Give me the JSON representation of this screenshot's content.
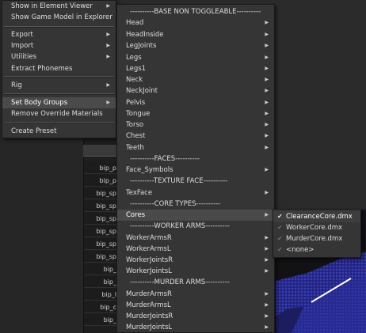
{
  "main_menu": {
    "items": [
      {
        "label": "Show in Element Viewer",
        "submenu": true
      },
      {
        "label": "Show Game Model in Explorer",
        "submenu": false
      },
      {
        "label": "Export",
        "submenu": true
      },
      {
        "label": "Import",
        "submenu": true
      },
      {
        "label": "Utilities",
        "submenu": true
      },
      {
        "label": "Extract Phonemes",
        "submenu": false
      },
      {
        "label": "Rig",
        "submenu": true
      },
      {
        "label": "Set Body Groups",
        "submenu": true,
        "highlighted": true
      },
      {
        "label": "Remove Override Materials",
        "submenu": false
      },
      {
        "label": "Create Preset",
        "submenu": false
      }
    ]
  },
  "body_groups_menu": {
    "headers": {
      "base": "----------BASE NON TOGGLEABLE----------",
      "faces": "----------FACES----------",
      "texture_face": "----------TEXTURE FACE----------",
      "core_types": "----------CORE TYPES----------",
      "worker_arms": "----------WORKER ARMS----------",
      "murder_arms": "----------MURDER ARMS----------"
    },
    "items": {
      "head": "Head",
      "headinside": "HeadInside",
      "legjoints": "LegJoints",
      "legs": "Legs",
      "legs1": "Legs1",
      "neck": "Neck",
      "neckjoint": "NeckJoint",
      "pelvis": "Pelvis",
      "tongue": "Tongue",
      "torso": "Torso",
      "chest": "Chest",
      "teeth": "Teeth",
      "face_symbols": "Face_Symbols",
      "texface": "TexFace",
      "cores": "Cores",
      "workerarmsr": "WorkerArmsR",
      "workerarmsl": "WorkerArmsL",
      "workerjointsr": "WorkerJointsR",
      "workerjointsl": "WorkerJointsL",
      "murderarmsr": "MurderArmsR",
      "murderarmsl": "MurderArmsL",
      "murderjointsr": "MurderJointsR",
      "murderjointsl": "MurderJointsL"
    }
  },
  "cores_menu": {
    "items": [
      {
        "label": "ClearanceCore.dmx",
        "checked": true
      },
      {
        "label": "WorkerCore.dmx",
        "checked": false
      },
      {
        "label": "MurderCore.dmx",
        "checked": false
      },
      {
        "label": "<none>",
        "checked": false
      }
    ]
  },
  "background_list": {
    "rows": [
      "bip_p",
      "bip_p",
      "bip_sp",
      "bip_sp",
      "bip_sp",
      "bip_sp",
      "bip_sp",
      "bip_sp",
      "bip_",
      "bip_",
      "bip_l",
      "bip_c",
      "bip_"
    ]
  },
  "icons": {
    "submenu_arrow": "submenu-arrow-icon",
    "checkmark": "checkmark-icon"
  },
  "colors": {
    "menu_bg": "#353535",
    "menu_highlight": "#4a4a4a",
    "viewport_mesh": "#2b2f9a"
  }
}
